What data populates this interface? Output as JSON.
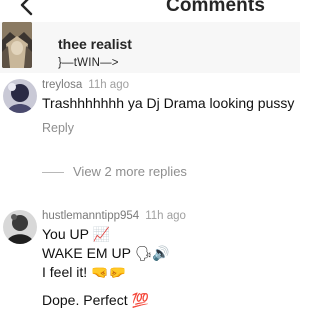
{
  "header": {
    "title": "Comments"
  },
  "caption": {
    "username": "thee realist",
    "bio": "}—tWIN—>"
  },
  "comments": [
    {
      "username": "treylosa",
      "time": "11h ago",
      "lines": [
        "Trashhhhhhh ya Dj Drama looking pussy"
      ],
      "reply_label": "Reply",
      "view_replies_label": "View 2 more replies"
    },
    {
      "username": "hustlemanntipp954",
      "time": "11h ago",
      "lines": [
        "You UP 📈",
        "WAKE EM UP 🗣🔊",
        "I feel it! 🤜🤛",
        "Dope. Perfect 💯"
      ]
    }
  ],
  "icons": [
    "back-chevron-icon"
  ],
  "colors": {
    "caption_background": "#f7f7f7",
    "muted_text": "#8e8e8e"
  }
}
